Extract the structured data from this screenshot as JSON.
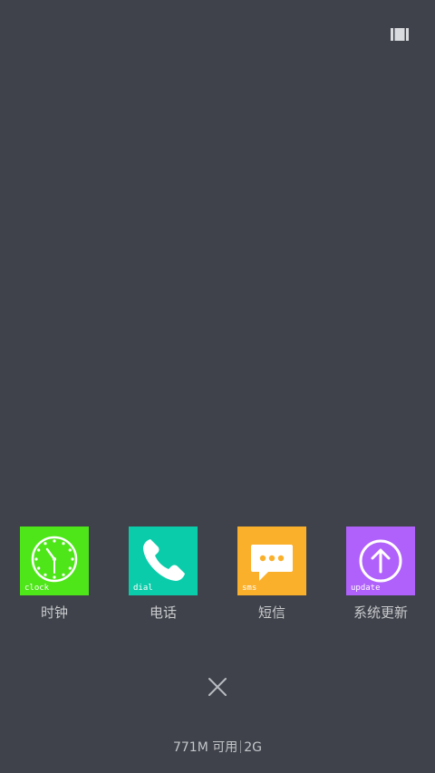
{
  "header": {
    "icon": "recent-apps-icon"
  },
  "apps": [
    {
      "tag": "clock",
      "label": "时钟",
      "color": "#4ee619",
      "icon": "clock-icon"
    },
    {
      "tag": "dial",
      "label": "电话",
      "color": "#0bccaa",
      "icon": "phone-icon"
    },
    {
      "tag": "sms",
      "label": "短信",
      "color": "#fbb02b",
      "icon": "message-icon"
    },
    {
      "tag": "update",
      "label": "系统更新",
      "color": "#b060fb",
      "icon": "arrow-up-circle-icon"
    }
  ],
  "close": {
    "icon": "close-icon"
  },
  "memory": {
    "available": "771M 可用",
    "total": "2G"
  }
}
